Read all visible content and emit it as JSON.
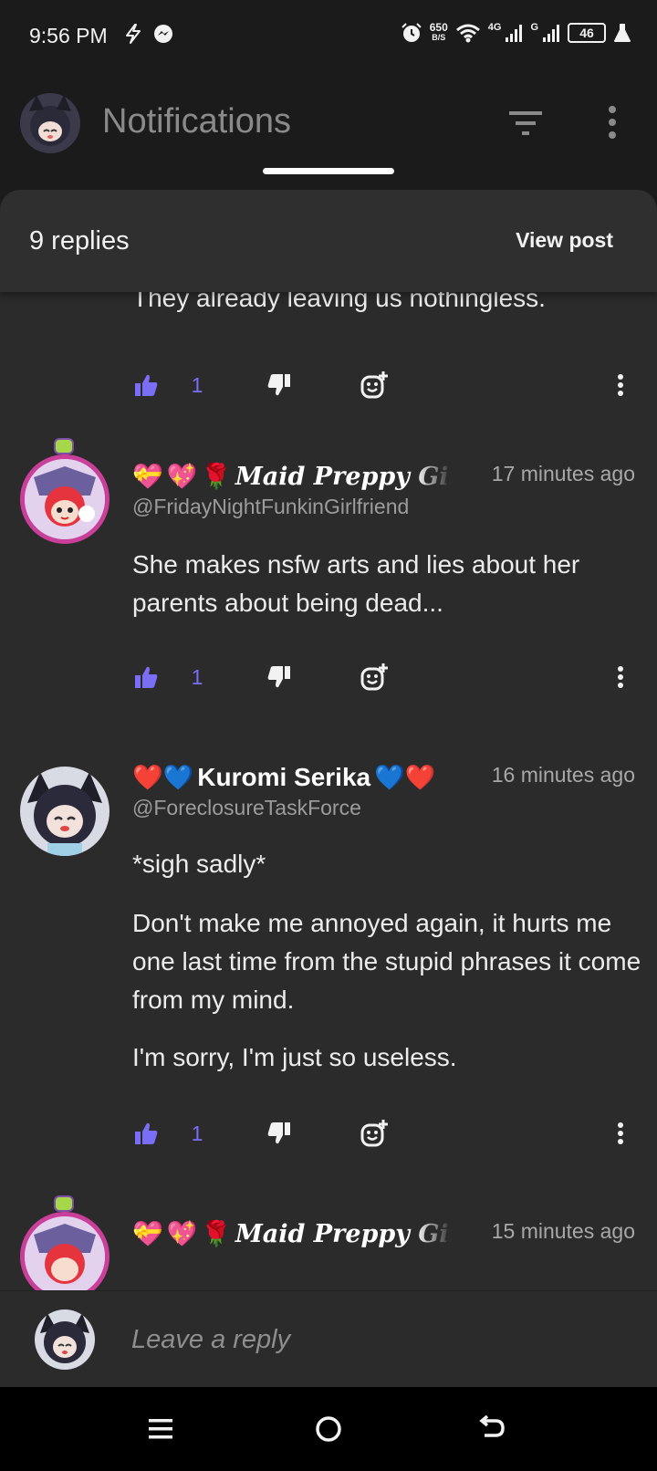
{
  "status_bar": {
    "time": "9:56 PM",
    "net_speed_value": "650",
    "net_speed_unit": "B/S",
    "signal_1_label": "4G",
    "signal_2_label": "G",
    "battery": "46",
    "icons": [
      "bolt-icon",
      "messenger-icon",
      "alarm-icon",
      "wifi-icon",
      "signal-icon",
      "battery-icon",
      "flask-icon"
    ]
  },
  "app_bar": {
    "title": "Notifications",
    "icons": [
      "avatar",
      "filter-icon",
      "more-vertical-icon"
    ]
  },
  "sheet": {
    "replies_count": "9 replies",
    "view_post_label": "View post"
  },
  "comments": [
    {
      "text_lines": [
        "They already leaving us nothingless."
      ],
      "like_count": "1"
    },
    {
      "name_emojis": [
        "💝",
        "💖",
        "🌹"
      ],
      "name": "Maid Preppy Girl",
      "handle": "@FridayNightFunkinGirlfriend",
      "time": "17 minutes ago",
      "text": "She makes nsfw arts and lies about her parents about being dead...",
      "like_count": "1"
    },
    {
      "name_prefix": "❤️💙",
      "name": "Kuromi Serika",
      "name_suffix": "💙❤️",
      "handle": "@ForeclosureTaskForce",
      "time": "16 minutes ago",
      "paragraphs": [
        "*sigh sadly*",
        "Don't make me annoyed again, it hurts me one last time from the stupid phrases it come from my mind.",
        "I'm sorry, I'm just so useless."
      ],
      "like_count": "1"
    },
    {
      "name_emojis": [
        "💝",
        "💖",
        "🌹"
      ],
      "name": "Maid Preppy Girl",
      "time": "15 minutes ago"
    }
  ],
  "reply_bar": {
    "placeholder": "Leave a reply"
  },
  "colors": {
    "background": "#1b1b1b",
    "sheet": "#2b2b2b",
    "accent": "#7b6ef6",
    "avatar_ring": "#c93f9a"
  }
}
